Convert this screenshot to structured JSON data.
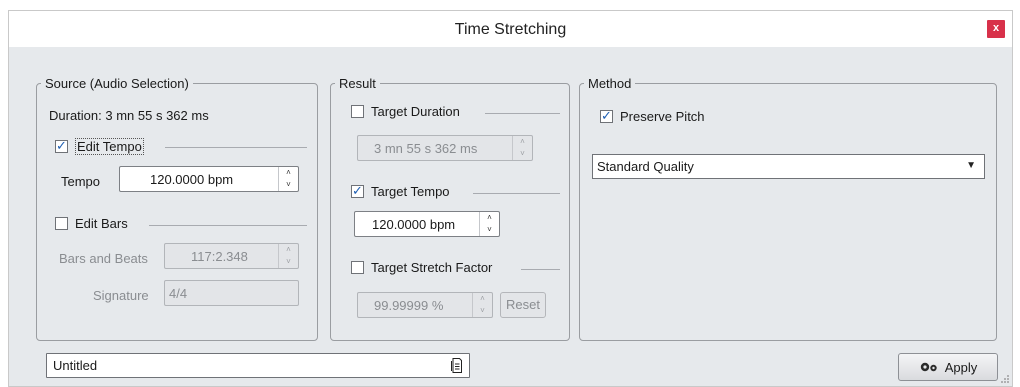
{
  "window": {
    "title": "Time Stretching",
    "close_label": "x"
  },
  "source": {
    "legend": "Source (Audio Selection)",
    "duration_label": "Duration:",
    "duration_value": "3 mn 55 s 362 ms",
    "edit_tempo_label": "Edit Tempo",
    "edit_tempo_checked": true,
    "tempo_label": "Tempo",
    "tempo_value": "120.0000 bpm",
    "edit_bars_label": "Edit Bars",
    "edit_bars_checked": false,
    "bars_beats_label": "Bars and Beats",
    "bars_beats_value": "117:2.348",
    "signature_label": "Signature",
    "signature_value": "4/4"
  },
  "result": {
    "legend": "Result",
    "target_duration_label": "Target Duration",
    "target_duration_checked": false,
    "target_duration_value": "3 mn 55 s 362 ms",
    "target_tempo_label": "Target Tempo",
    "target_tempo_checked": true,
    "target_tempo_value": "120.0000 bpm",
    "target_stretch_label": "Target Stretch Factor",
    "target_stretch_checked": false,
    "target_stretch_value": "99.99999 %",
    "reset_label": "Reset"
  },
  "method": {
    "legend": "Method",
    "preserve_pitch_label": "Preserve Pitch",
    "preserve_pitch_checked": true,
    "quality_value": "Standard Quality"
  },
  "footer": {
    "preset_value": "Untitled",
    "apply_label": "Apply"
  },
  "icons": {
    "spin_up": "˄",
    "spin_down": "˅",
    "caret_down": "▼",
    "checkmark": "✓"
  }
}
